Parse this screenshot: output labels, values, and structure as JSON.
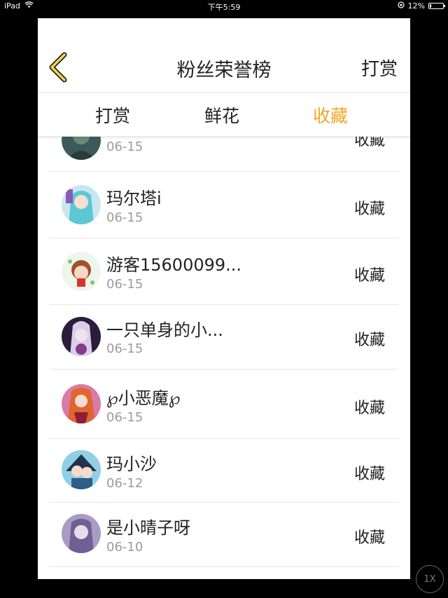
{
  "status_bar": {
    "device": "iPad",
    "time": "下午5:59",
    "battery": "12%",
    "battery_level": 0.12
  },
  "nav": {
    "title": "粉丝荣誉榜",
    "right_action": "打赏",
    "back_icon": "chevron-left-icon"
  },
  "tabs": [
    {
      "label": "打赏",
      "active": false
    },
    {
      "label": "鲜花",
      "active": false
    },
    {
      "label": "收藏",
      "active": true
    }
  ],
  "accent_color": "#f5a623",
  "list": [
    {
      "name": "",
      "date": "06-15",
      "action": "收藏"
    },
    {
      "name": "玛尔塔i",
      "date": "06-15",
      "action": "收藏"
    },
    {
      "name": "游客15600099...",
      "date": "06-15",
      "action": "收藏"
    },
    {
      "name": "一只单身的小...",
      "date": "06-15",
      "action": "收藏"
    },
    {
      "name": "℘小恶魔℘",
      "date": "06-15",
      "action": "收藏"
    },
    {
      "name": "玛小沙",
      "date": "06-12",
      "action": "收藏"
    },
    {
      "name": "是小晴子呀",
      "date": "06-10",
      "action": "收藏"
    }
  ],
  "speed_button": "1X"
}
